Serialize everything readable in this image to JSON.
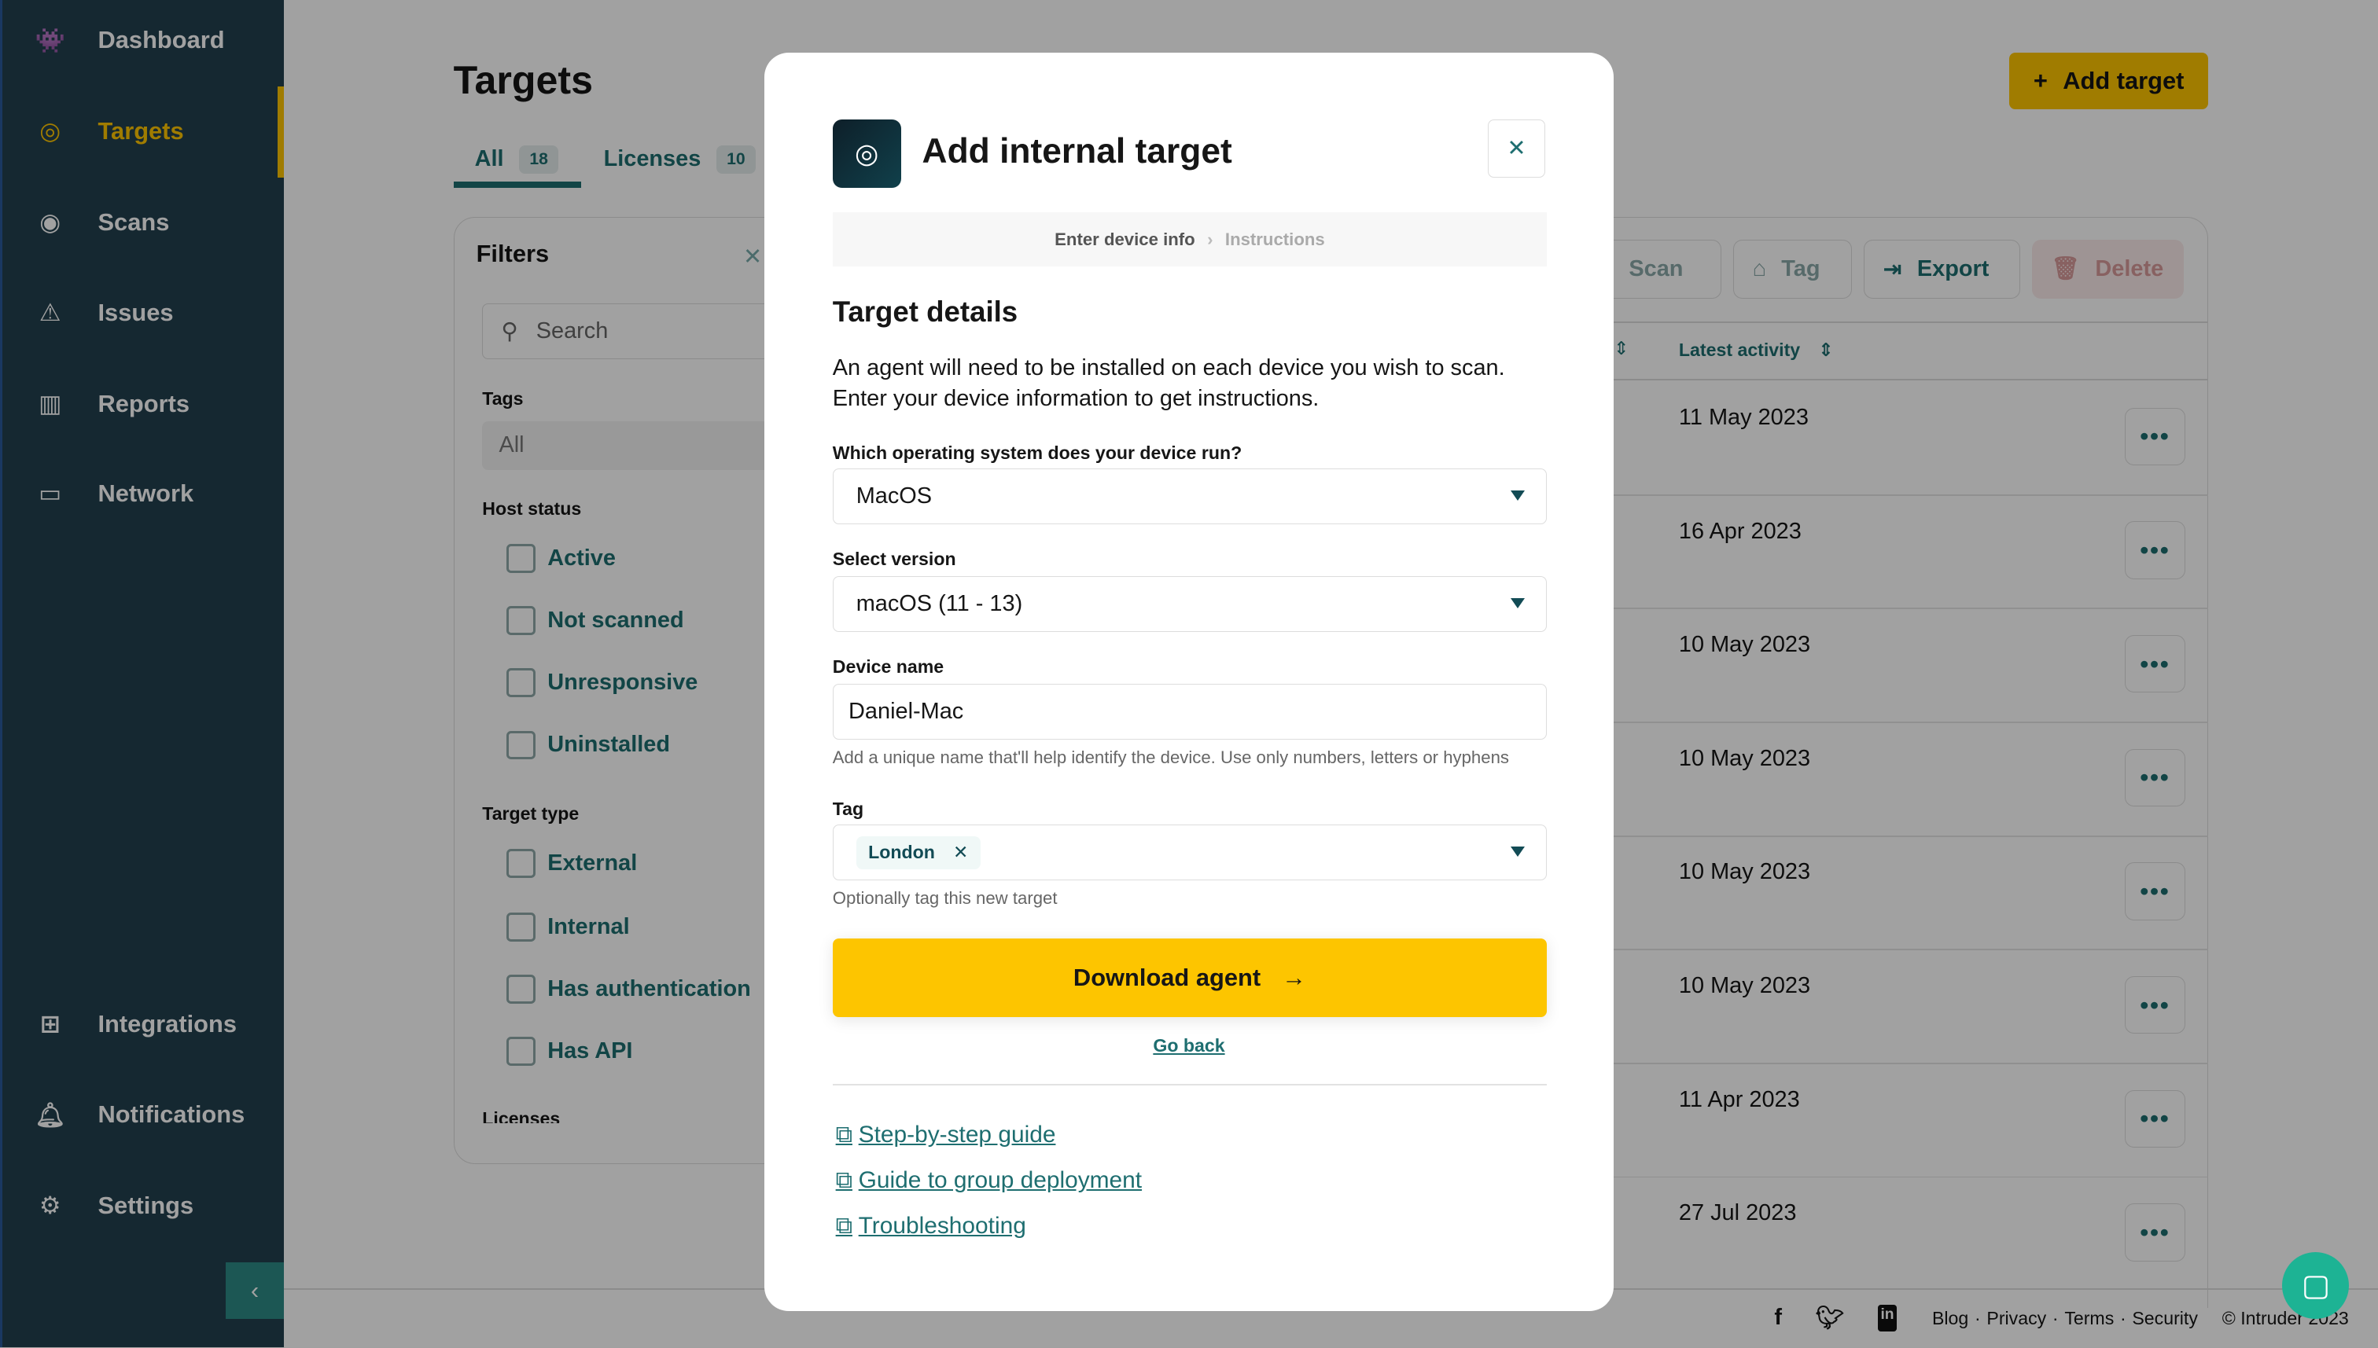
{
  "sidebar": {
    "items": [
      {
        "label": "Dashboard",
        "icon": "space-invader-icon"
      },
      {
        "label": "Targets",
        "icon": "target-icon",
        "active": true
      },
      {
        "label": "Scans",
        "icon": "radar-icon"
      },
      {
        "label": "Issues",
        "icon": "warning-icon"
      },
      {
        "label": "Reports",
        "icon": "bar-chart-icon"
      },
      {
        "label": "Network",
        "icon": "laptop-icon"
      },
      {
        "label": "Integrations",
        "icon": "grid-plus-icon"
      },
      {
        "label": "Notifications",
        "icon": "bell-icon"
      },
      {
        "label": "Settings",
        "icon": "gear-icon"
      }
    ]
  },
  "page": {
    "title": "Targets",
    "add_target": "Add target",
    "tabs": [
      {
        "label": "All",
        "count": "18"
      },
      {
        "label": "Licenses",
        "count": "10"
      }
    ]
  },
  "filters": {
    "title": "Filters",
    "search_placeholder": "Search",
    "tags_label": "Tags",
    "tags_value": "All",
    "host_status_label": "Host status",
    "host_status": [
      "Active",
      "Not scanned",
      "Unresponsive",
      "Uninstalled"
    ],
    "target_type_label": "Target type",
    "target_type": [
      "External",
      "Internal",
      "Has authentication",
      "Has API"
    ],
    "licenses_label": "Licenses"
  },
  "toolbar": {
    "scan": "Scan",
    "tag": "Tag",
    "export": "Export",
    "delete": "Delete"
  },
  "table": {
    "latest_activity": "Latest activity",
    "rows": [
      "11 May 2023",
      "16 Apr 2023",
      "10 May 2023",
      "10 May 2023",
      "10 May 2023",
      "10 May 2023",
      "11 Apr 2023",
      "27 Jul 2023"
    ]
  },
  "footer": {
    "links": [
      "Blog",
      "Privacy",
      "Terms",
      "Security"
    ],
    "copyright": "© Intruder 2023"
  },
  "modal": {
    "title": "Add internal target",
    "steps": [
      "Enter device info",
      "Instructions"
    ],
    "section_title": "Target details",
    "intro_1": "An agent will need to be installed on each device you wish to scan.",
    "intro_2": "Enter your device information to get instructions.",
    "os_label": "Which operating system does your device run?",
    "os_value": "MacOS",
    "version_label": "Select version",
    "version_value": "macOS (11 - 13)",
    "device_label": "Device name",
    "device_value": "Daniel-Mac",
    "device_help": "Add a unique name that'll help identify the device. Use only numbers, letters or hyphens",
    "tag_label": "Tag",
    "tag_chip": "London",
    "tag_help": "Optionally tag this new target",
    "download": "Download agent",
    "go_back": "Go back",
    "links": [
      "Step-by-step guide",
      "Guide to group deployment",
      "Troubleshooting"
    ]
  },
  "colors": {
    "accent": "#fdc500",
    "teal": "#1e6e70",
    "sidebar": "#22404f"
  }
}
